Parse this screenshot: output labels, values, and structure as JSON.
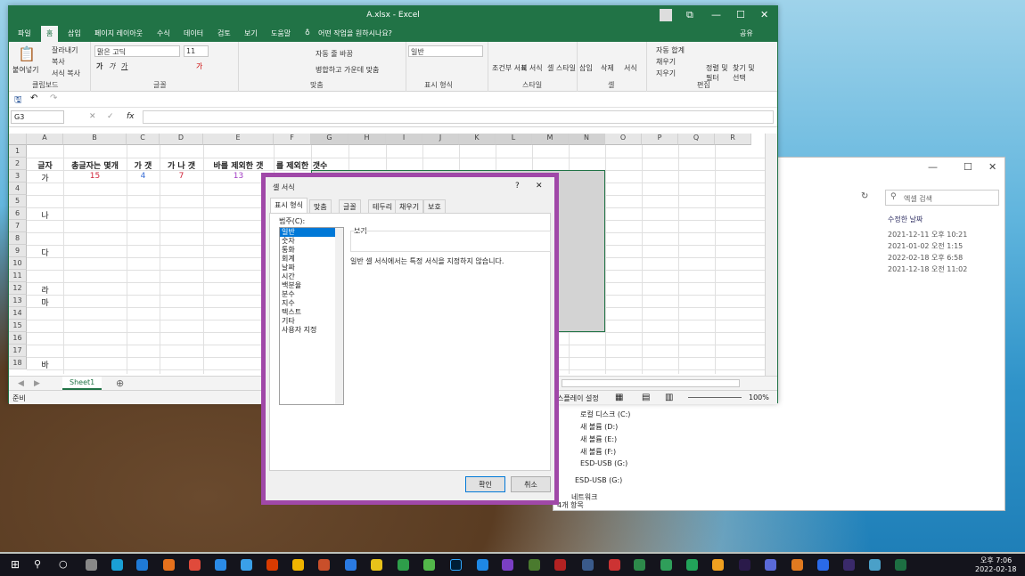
{
  "excel": {
    "title": "A.xlsx  -  Excel",
    "tabs": [
      "파일",
      "홈",
      "삽입",
      "페이지 레이아웃",
      "수식",
      "데이터",
      "검토",
      "보기",
      "도움말"
    ],
    "tell_me": "어떤 작업을 원하시나요?",
    "share": "공유",
    "ribbon": {
      "paste": "붙여넣기",
      "cut": "잘라내기",
      "copy": "복사",
      "format_painter": "서식 복사",
      "clipboard": "클립보드",
      "font_name": "맑은 고딕",
      "font_size": "11",
      "font_group": "글꼴",
      "wrap": "자동 줄 바꿈",
      "merge": "병합하고 가운데 맞춤",
      "align_group": "맞춤",
      "number_format": "일반",
      "number_group": "표시 형식",
      "cond_format": "조건부 서식",
      "table_format": "표 서식",
      "cell_style": "셀 스타일",
      "style_group": "스타일",
      "insert": "삽입",
      "delete": "삭제",
      "format": "서식",
      "cells_group": "셀",
      "autosum": "자동 합계",
      "fill": "채우기",
      "clear": "지우기",
      "sort_filter": "정렬 및 필터",
      "find_select": "찾기 및 선택",
      "edit_group": "편집"
    },
    "name_box": "G3",
    "columns": [
      "A",
      "B",
      "C",
      "D",
      "E",
      "F",
      "G",
      "H",
      "I",
      "J",
      "K",
      "L",
      "M",
      "N",
      "O",
      "P",
      "Q",
      "R"
    ],
    "rows": [
      "1",
      "2",
      "3",
      "4",
      "5",
      "6",
      "7",
      "8",
      "9",
      "10",
      "11",
      "12",
      "13",
      "14",
      "15",
      "16",
      "17",
      "18"
    ],
    "headers": [
      "글자",
      "총글자는 몇개",
      "가 갯",
      "가 나 갯",
      "바를 제외한 갯",
      "를 제외한",
      "갯수"
    ],
    "row3": {
      "a": "가",
      "b": "15",
      "c": "4",
      "d": "7",
      "e": "13"
    },
    "col_a": {
      "r6": "나",
      "r9": "다",
      "r12": "라",
      "r13": "마",
      "r18": "바"
    },
    "sheet": "Sheet1",
    "status": "준비",
    "status_display": "스플레이 설정",
    "zoom": "100%"
  },
  "dialog": {
    "title": "셀 서식",
    "help": "?",
    "close": "✕",
    "tabs": [
      "표시 형식",
      "맞춤",
      "글꼴",
      "테두리",
      "채우기",
      "보호"
    ],
    "category_label": "범주(C):",
    "categories": [
      "일반",
      "숫자",
      "통화",
      "회계",
      "날짜",
      "시간",
      "백분율",
      "분수",
      "지수",
      "텍스트",
      "기타",
      "사용자 지정"
    ],
    "preview_label": "보기",
    "description": "일반 셀 서식에서는 특정 서식을 지정하지 않습니다.",
    "ok": "확인",
    "cancel": "취소"
  },
  "explorer": {
    "search": "엑셀 검색",
    "date_header": "수정한 날짜",
    "dates": [
      "2021-12-11 오후 10:21",
      "2021-01-02 오전 1:15",
      "2022-02-18 오후 6:58",
      "2021-12-18 오전 11:02"
    ],
    "drives": [
      "로컬 디스크 (C:)",
      "새 볼륨 (D:)",
      "새 볼륨 (E:)",
      "새 볼륨 (F:)",
      "ESD-USB (G:)",
      "ESD-USB (G:)",
      "네트워크"
    ],
    "count": "4개 항목"
  },
  "taskbar": {
    "time": "오후 7:06",
    "date": "2022-02-18"
  }
}
